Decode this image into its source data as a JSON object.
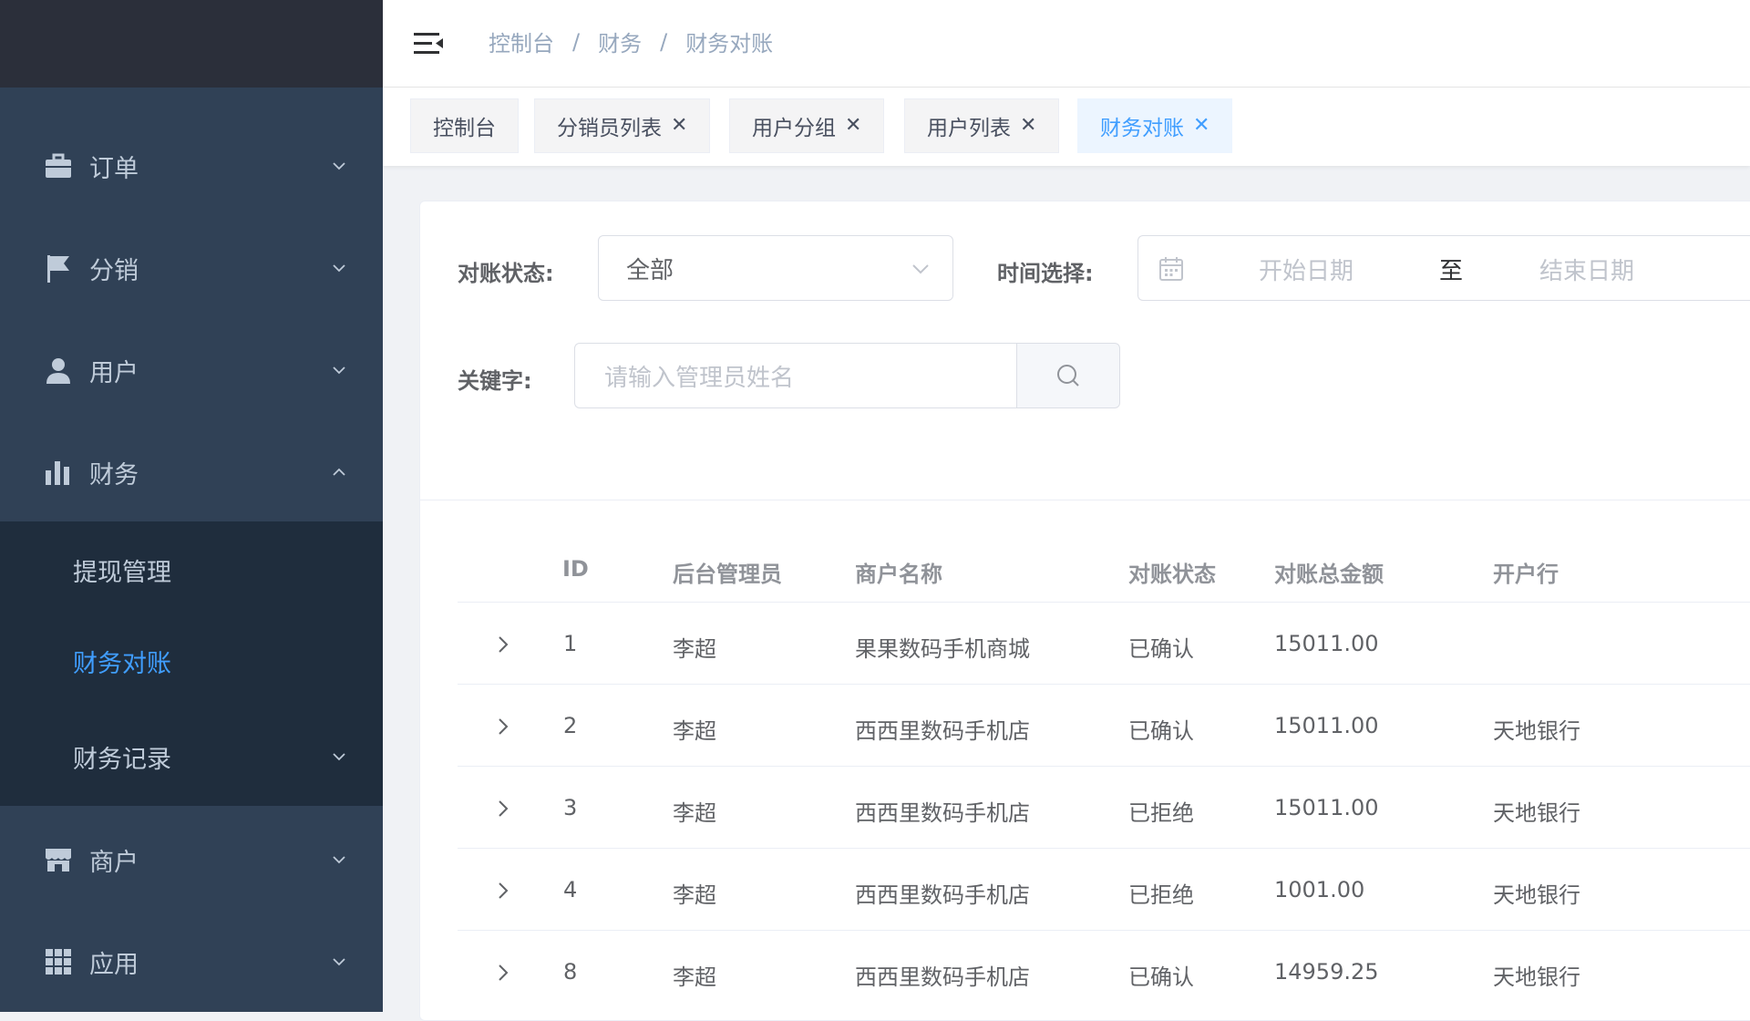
{
  "sidebar": {
    "menus": [
      {
        "label": "订单",
        "icon": "briefcase-icon",
        "expanded": false
      },
      {
        "label": "分销",
        "icon": "flag-icon",
        "expanded": false
      },
      {
        "label": "用户",
        "icon": "user-icon",
        "expanded": false
      },
      {
        "label": "财务",
        "icon": "bar-chart-icon",
        "expanded": true
      },
      {
        "label": "商户",
        "icon": "store-icon",
        "expanded": false
      },
      {
        "label": "应用",
        "icon": "grid-icon",
        "expanded": false
      }
    ],
    "finance_submenu": [
      {
        "label": "提现管理",
        "active": false
      },
      {
        "label": "财务对账",
        "active": true
      },
      {
        "label": "财务记录",
        "active": false
      }
    ]
  },
  "breadcrumb": [
    "控制台",
    "财务",
    "财务对账"
  ],
  "tags": [
    {
      "label": "控制台",
      "closable": false,
      "active": false
    },
    {
      "label": "分销员列表",
      "closable": true,
      "active": false
    },
    {
      "label": "用户分组",
      "closable": true,
      "active": false
    },
    {
      "label": "用户列表",
      "closable": true,
      "active": false
    },
    {
      "label": "财务对账",
      "closable": true,
      "active": true
    }
  ],
  "filters": {
    "status_label": "对账状态:",
    "status_value": "全部",
    "time_label": "时间选择:",
    "start_placeholder": "开始日期",
    "range_separator": "至",
    "end_placeholder": "结束日期",
    "keyword_label": "关键字:",
    "keyword_placeholder": "请输入管理员姓名"
  },
  "table": {
    "columns": [
      "ID",
      "后台管理员",
      "商户名称",
      "对账状态",
      "对账总金额",
      "开户行"
    ],
    "rows": [
      {
        "id": "1",
        "admin": "李超",
        "merchant": "果果数码手机商城",
        "status": "已确认",
        "amount": "15011.00",
        "bank": ""
      },
      {
        "id": "2",
        "admin": "李超",
        "merchant": "西西里数码手机店",
        "status": "已确认",
        "amount": "15011.00",
        "bank": "天地银行"
      },
      {
        "id": "3",
        "admin": "李超",
        "merchant": "西西里数码手机店",
        "status": "已拒绝",
        "amount": "15011.00",
        "bank": "天地银行"
      },
      {
        "id": "4",
        "admin": "李超",
        "merchant": "西西里数码手机店",
        "status": "已拒绝",
        "amount": "1001.00",
        "bank": "天地银行"
      },
      {
        "id": "8",
        "admin": "李超",
        "merchant": "西西里数码手机店",
        "status": "已确认",
        "amount": "14959.25",
        "bank": "天地银行"
      }
    ]
  },
  "colors": {
    "sidebar_bg": "#304156",
    "submenu_bg": "#1f2d3d",
    "accent": "#409eff"
  }
}
